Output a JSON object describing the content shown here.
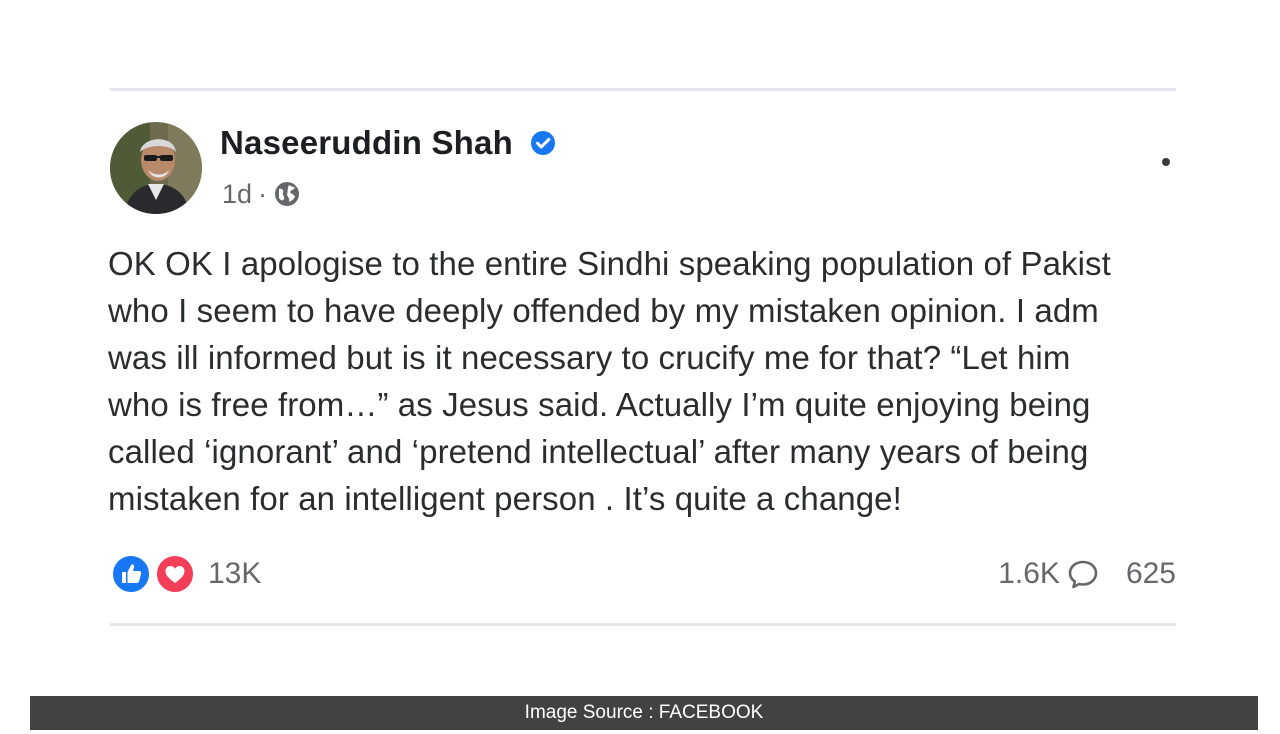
{
  "post": {
    "author": "Naseeruddin Shah",
    "time": "1d",
    "meta_separator": "·",
    "audience_icon": "globe-icon",
    "verified_icon": "verified-badge-icon",
    "more_icon": "more-options-icon",
    "lines": [
      "OK OK I apologise to the entire Sindhi speaking population of Pakist",
      "who I seem to have deeply offended by my mistaken opinion. I adm",
      "was ill informed  but is it necessary to crucify me for that? “Let him",
      "who is free from…” as Jesus said. Actually I’m quite enjoying being",
      "called ‘ignorant’ and ‘pretend intellectual’ after many years of being",
      "mistaken for an intelligent person . It’s quite a change!"
    ]
  },
  "stats": {
    "reaction_icons": [
      "like-icon",
      "love-icon"
    ],
    "reactions": "13K",
    "comments": "1.6K",
    "comment_icon": "comment-icon",
    "shares": "625"
  },
  "colors": {
    "accent": "#1877f2",
    "love": "#f33e58",
    "muted_text": "#65676b",
    "caption_bar": "#424242"
  },
  "caption": {
    "text": "Image Source : FACEBOOK"
  }
}
